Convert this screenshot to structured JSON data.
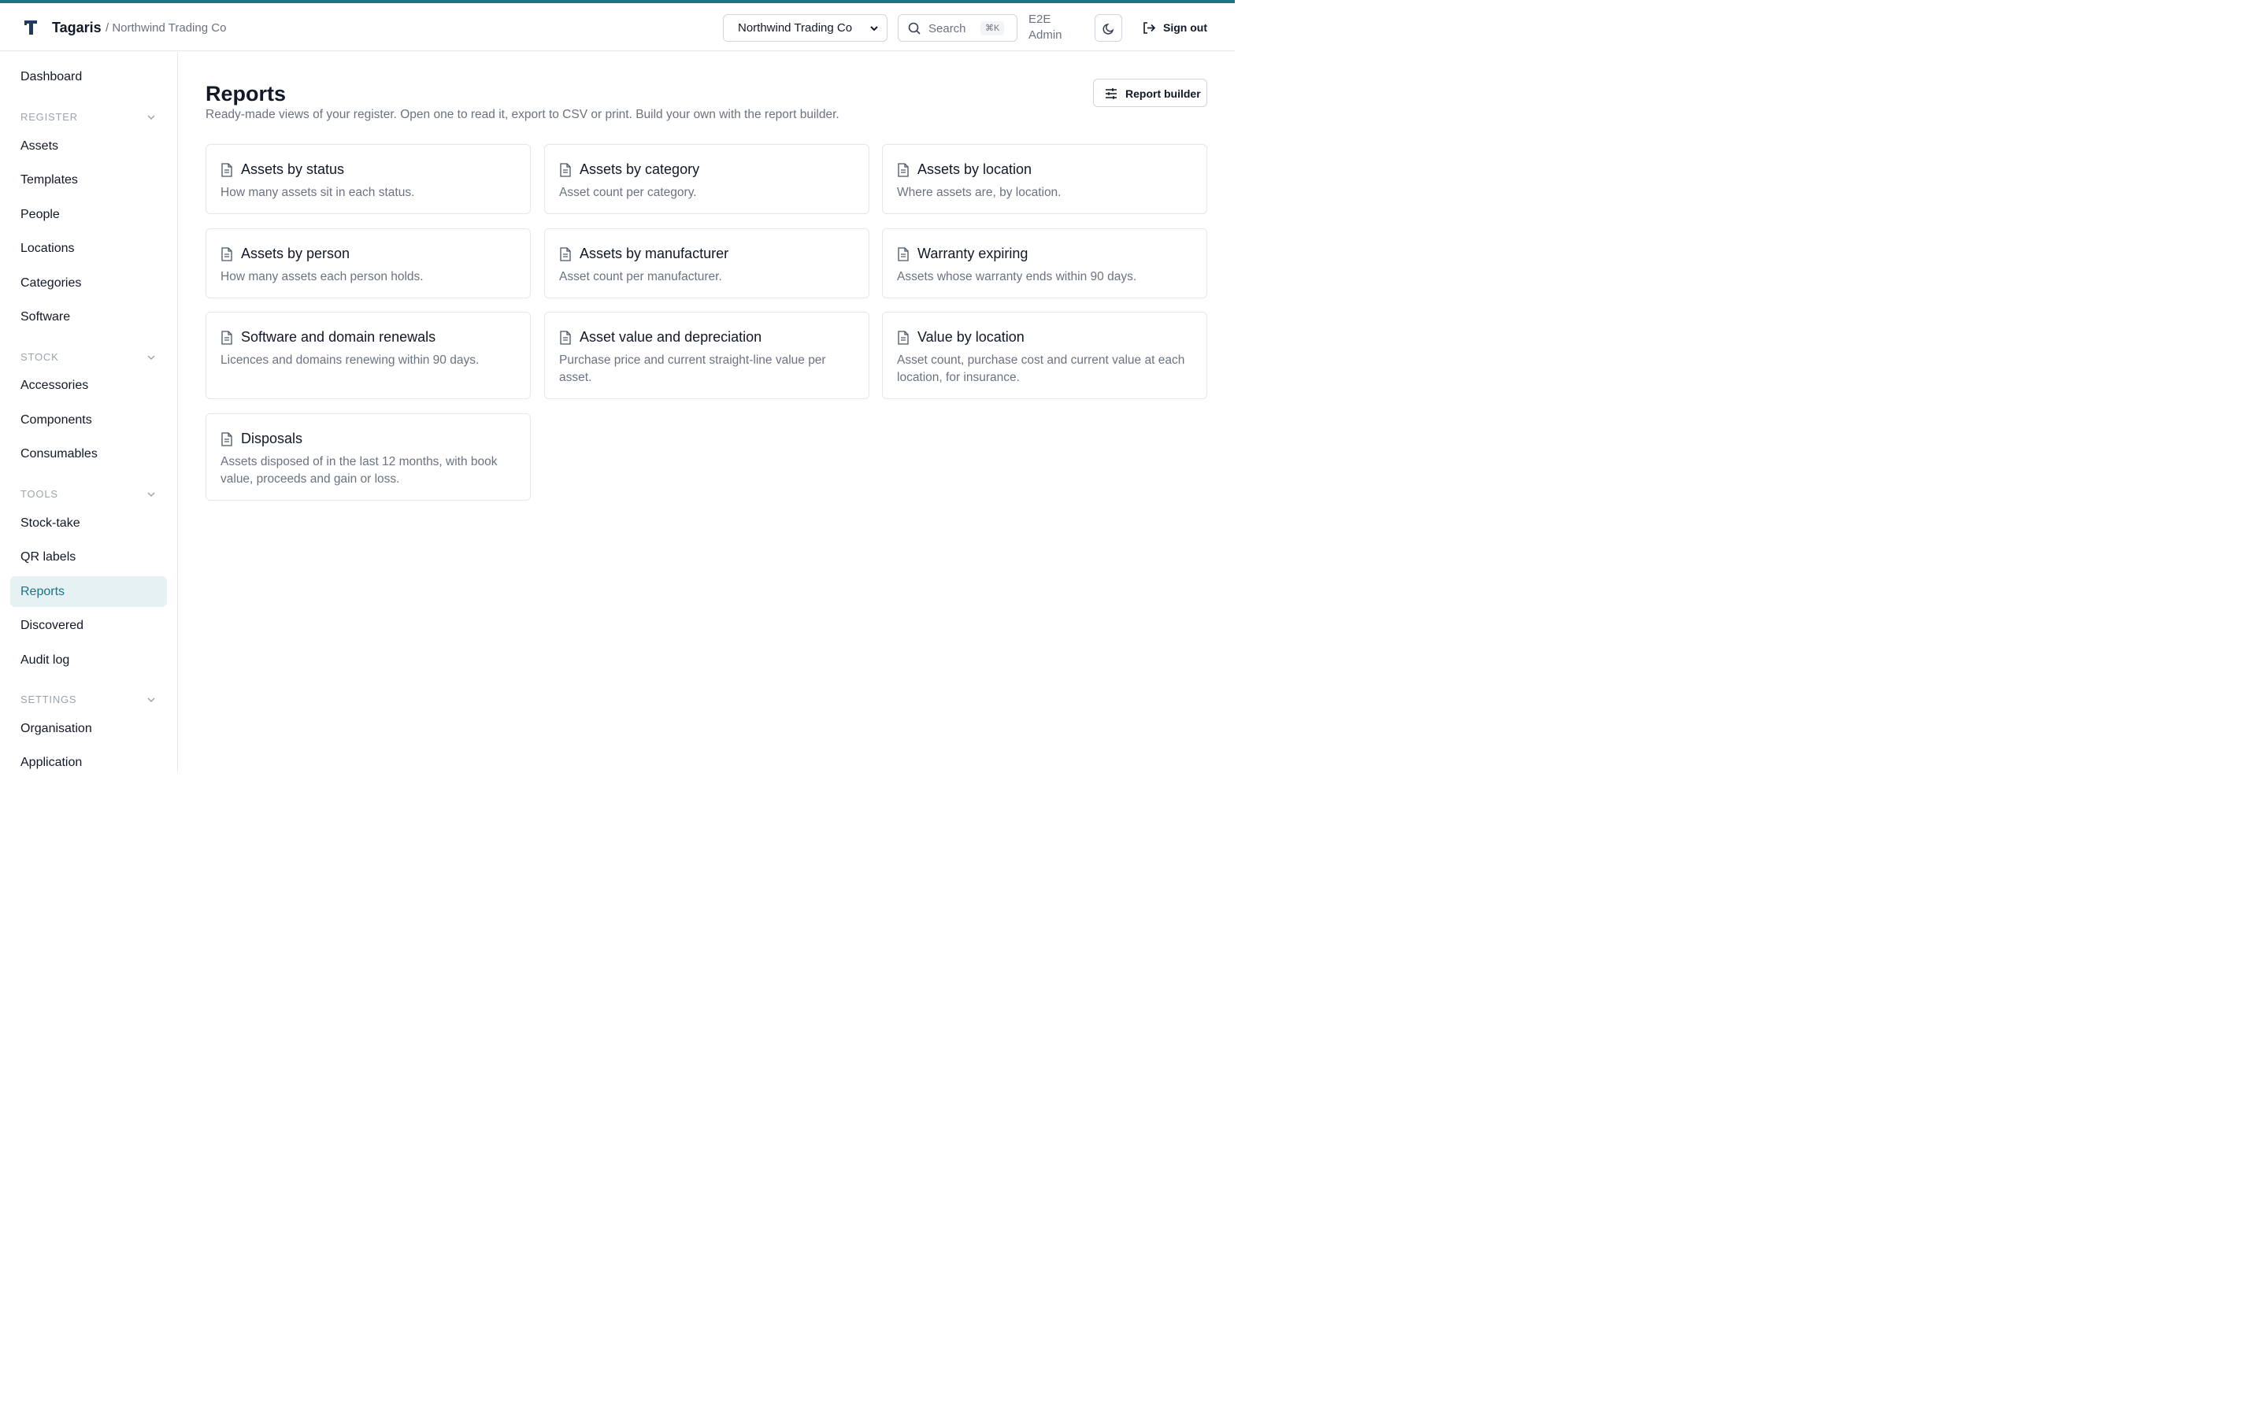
{
  "colors": {
    "accent": "#1a7585",
    "active_bg": "#e6f1f3",
    "muted": "#6b7280",
    "border": "#e5e7eb"
  },
  "header": {
    "brand": "Tagaris",
    "breadcrumb": "/ Northwind Trading Co",
    "org_select": "Northwind Trading Co",
    "search_placeholder": "Search",
    "search_shortcut": "⌘K",
    "user": "E2E Admin",
    "signout": "Sign out"
  },
  "sidebar": {
    "dashboard": "Dashboard",
    "sections": [
      {
        "label": "REGISTER",
        "items": [
          "Assets",
          "Templates",
          "People",
          "Locations",
          "Categories",
          "Software"
        ]
      },
      {
        "label": "STOCK",
        "items": [
          "Accessories",
          "Components",
          "Consumables"
        ]
      },
      {
        "label": "TOOLS",
        "items": [
          "Stock-take",
          "QR labels",
          "Reports",
          "Discovered",
          "Audit log"
        ]
      },
      {
        "label": "SETTINGS",
        "items": [
          "Organisation",
          "Application"
        ]
      }
    ],
    "active": "Reports"
  },
  "main": {
    "title": "Reports",
    "subtitle": "Ready-made views of your register. Open one to read it, export to CSV or print. Build your own with the report builder.",
    "report_builder": "Report builder",
    "cards": [
      {
        "title": "Assets by status",
        "desc": "How many assets sit in each status."
      },
      {
        "title": "Assets by category",
        "desc": "Asset count per category."
      },
      {
        "title": "Assets by location",
        "desc": "Where assets are, by location."
      },
      {
        "title": "Assets by person",
        "desc": "How many assets each person holds."
      },
      {
        "title": "Assets by manufacturer",
        "desc": "Asset count per manufacturer."
      },
      {
        "title": "Warranty expiring",
        "desc": "Assets whose warranty ends within 90 days."
      },
      {
        "title": "Software and domain renewals",
        "desc": "Licences and domains renewing within 90 days."
      },
      {
        "title": "Asset value and depreciation",
        "desc": "Purchase price and current straight-line value per asset."
      },
      {
        "title": "Value by location",
        "desc": "Asset count, purchase cost and current value at each location, for insurance."
      },
      {
        "title": "Disposals",
        "desc": "Assets disposed of in the last 12 months, with book value, proceeds and gain or loss."
      }
    ]
  }
}
